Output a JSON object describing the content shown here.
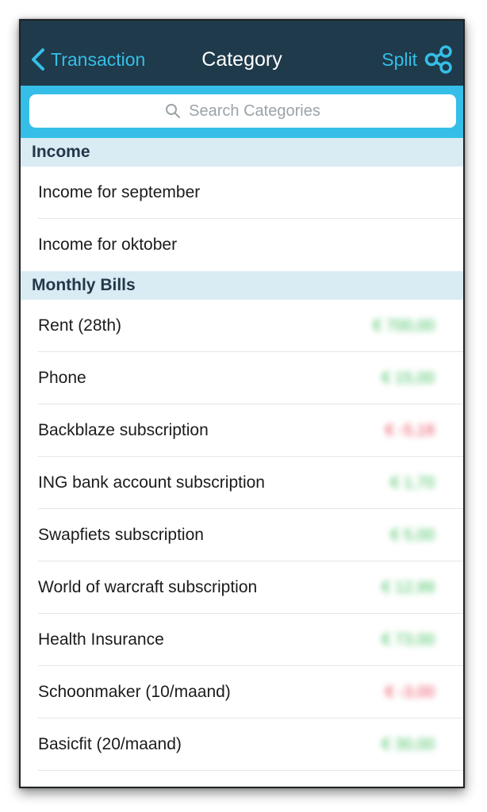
{
  "navbar": {
    "back_label": "Transaction",
    "title": "Category",
    "split_label": "Split",
    "accent_color": "#35bfe8",
    "background_color": "#1f3a4a"
  },
  "search": {
    "placeholder": "Search Categories"
  },
  "sections": [
    {
      "header": "Income",
      "rows": [
        {
          "label": "Income for september",
          "amount": ""
        },
        {
          "label": "Income for oktober",
          "amount": ""
        }
      ]
    },
    {
      "header": "Monthly Bills",
      "rows": [
        {
          "label": "Rent (28th)",
          "amount": "€ 700,00",
          "sign": "pos"
        },
        {
          "label": "Phone",
          "amount": "€ 15,00",
          "sign": "pos"
        },
        {
          "label": "Backblaze subscription",
          "amount": "€ -5,18",
          "sign": "neg"
        },
        {
          "label": "ING bank account subscription",
          "amount": "€ 1,70",
          "sign": "pos"
        },
        {
          "label": "Swapfiets subscription",
          "amount": "€ 5,00",
          "sign": "pos"
        },
        {
          "label": "World of warcraft subscription",
          "amount": "€ 12,99",
          "sign": "pos"
        },
        {
          "label": "Health Insurance",
          "amount": "€ 73,00",
          "sign": "pos"
        },
        {
          "label": "Schoonmaker (10/maand)",
          "amount": "€ -3,00",
          "sign": "neg"
        },
        {
          "label": "Basicfit (20/maand)",
          "amount": "€ 30,00",
          "sign": "pos"
        }
      ]
    }
  ]
}
